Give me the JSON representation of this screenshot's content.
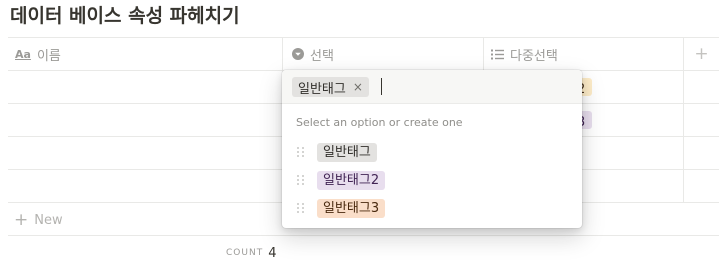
{
  "page": {
    "title": "데이터 베이스 속성 파헤치기"
  },
  "table": {
    "columns": [
      {
        "label": "이름",
        "icon": "text-property-icon",
        "icon_text": "Aa"
      },
      {
        "label": "선택",
        "icon": "select-property-icon"
      },
      {
        "label": "다중선택",
        "icon": "multi-select-property-icon"
      }
    ],
    "add_column_label": "+",
    "new_row_label": "New",
    "new_row_icon": "+",
    "footer": {
      "count_label": "COUNT",
      "count_value": "4"
    },
    "peek": {
      "row1_tag_fragment": "2",
      "row2_tag_fragment": "3"
    }
  },
  "popup": {
    "selected_chip": {
      "label": "일반태그",
      "remove_icon": "×"
    },
    "search_value": "",
    "hint": "Select an option or create one",
    "options": [
      {
        "label": "일반태그",
        "color": "#e3e2e0",
        "text_color": "#32302c"
      },
      {
        "label": "일반태그2",
        "color": "#e8deee",
        "text_color": "#412454"
      },
      {
        "label": "일반태그3",
        "color": "#fadec9",
        "text_color": "#49290e"
      }
    ]
  },
  "colors": {
    "border": "#e9e9e7",
    "muted_text": "#9b9a97",
    "text": "#37352f"
  }
}
